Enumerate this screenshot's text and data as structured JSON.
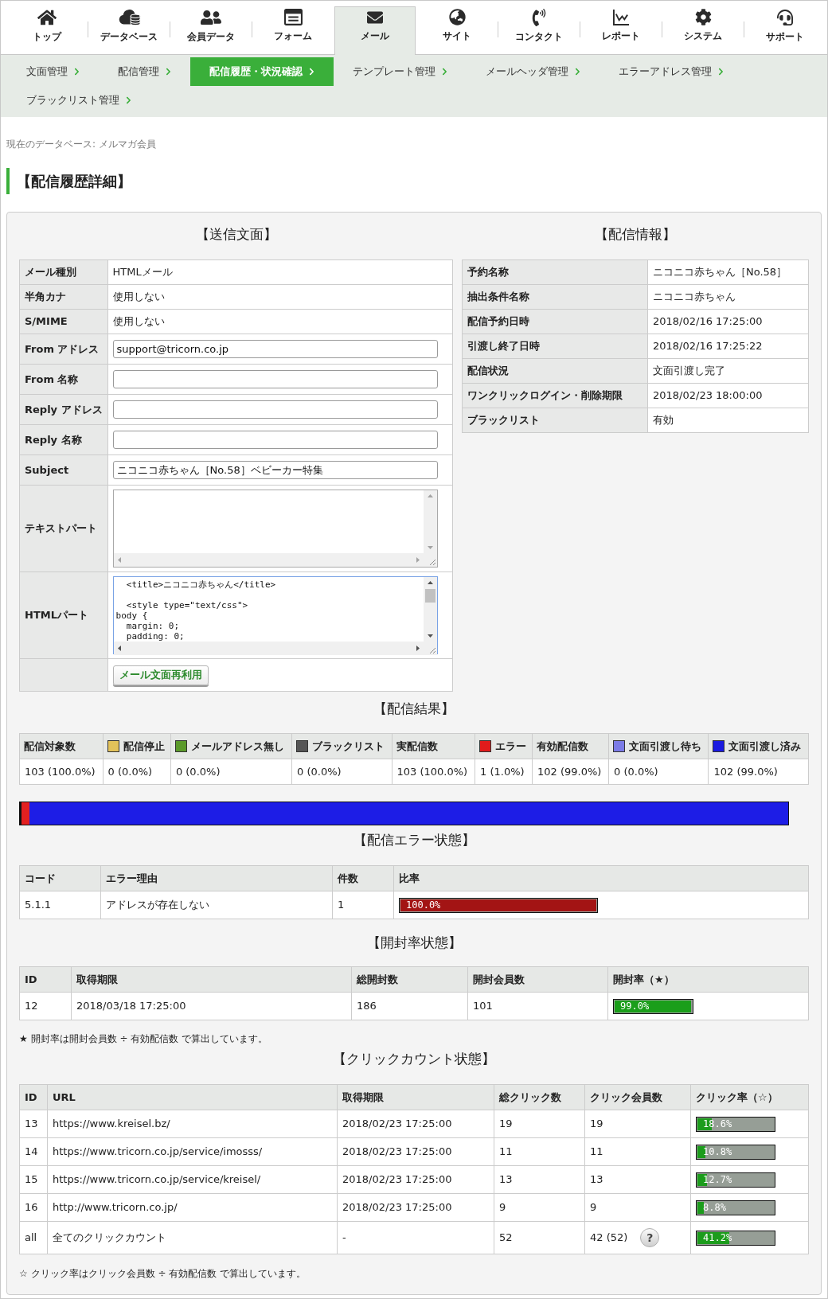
{
  "top_nav": {
    "items": [
      {
        "label": "トップ",
        "selected": false
      },
      {
        "label": "データベース",
        "selected": false
      },
      {
        "label": "会員データ",
        "selected": false
      },
      {
        "label": "フォーム",
        "selected": false
      },
      {
        "label": "メール",
        "selected": true
      },
      {
        "label": "サイト",
        "selected": false
      },
      {
        "label": "コンタクト",
        "selected": false
      },
      {
        "label": "レポート",
        "selected": false
      },
      {
        "label": "システム",
        "selected": false
      },
      {
        "label": "サポート",
        "selected": false
      }
    ]
  },
  "sub_nav": {
    "items": [
      {
        "label": "文面管理",
        "selected": false
      },
      {
        "label": "配信管理",
        "selected": false
      },
      {
        "label": "配信履歴・状況確認",
        "selected": true
      },
      {
        "label": "テンプレート管理",
        "selected": false
      },
      {
        "label": "メールヘッダ管理",
        "selected": false
      },
      {
        "label": "エラーアドレス管理",
        "selected": false
      },
      {
        "label": "ブラックリスト管理",
        "selected": false
      }
    ]
  },
  "current_database": "現在のデータベース: メルマガ会員",
  "page_title": "【配信履歴詳細】",
  "mail_content": {
    "title": "【送信文面】",
    "rows": [
      {
        "kind": "text",
        "label": "メール種別",
        "value": "HTMLメール"
      },
      {
        "kind": "text",
        "label": "半角カナ",
        "value": "使用しない"
      },
      {
        "kind": "text",
        "label": "S/MIME",
        "value": "使用しない"
      },
      {
        "kind": "input",
        "label": "From アドレス",
        "value": "support@tricorn.co.jp"
      },
      {
        "kind": "input",
        "label": "From 名称"
      },
      {
        "kind": "input",
        "label": "Reply アドレス"
      },
      {
        "kind": "input",
        "label": "Reply 名称"
      },
      {
        "kind": "input",
        "label": "Subject",
        "value": "ニコニコ赤ちゃん［No.58］ベビーカー特集"
      },
      {
        "kind": "textarea",
        "label": "テキストパート",
        "focused": false
      },
      {
        "kind": "textarea",
        "label": "HTMLパート",
        "focused": true,
        "value": "  <title>ニコニコ赤ちゃん</title>\n\n  <style type=\"text/css\">\nbody {\n  margin: 0;\n  padding: 0;"
      },
      {
        "kind": "button",
        "button": "メール文面再利用"
      }
    ]
  },
  "delivery_info": {
    "title": "【配信情報】",
    "rows": [
      {
        "label": "予約名称",
        "value": "ニコニコ赤ちゃん［No.58］"
      },
      {
        "label": "抽出条件名称",
        "value": "ニコニコ赤ちゃん"
      },
      {
        "label": "配信予約日時",
        "value": "2018/02/16 17:25:00"
      },
      {
        "label": "引渡し終了日時",
        "value": "2018/02/16 17:25:22"
      },
      {
        "label": "配信状況",
        "value": "文面引渡し完了"
      },
      {
        "label": "ワンクリックログイン・削除期限",
        "value": "2018/02/23 18:00:00"
      },
      {
        "label": "ブラックリスト",
        "value": "有効"
      }
    ]
  },
  "delivery_results": {
    "title": "【配信結果】",
    "columns": [
      {
        "label": "配信対象数"
      },
      {
        "label": "配信停止",
        "color": "#e3c25a"
      },
      {
        "label": "メールアドレス無し",
        "color": "#5b9a2a"
      },
      {
        "label": "ブラックリスト",
        "color": "#555555"
      },
      {
        "label": "実配信数"
      },
      {
        "label": "エラー",
        "color": "#e01b1b"
      },
      {
        "label": "有効配信数"
      },
      {
        "label": "文面引渡し待ち",
        "color": "#7b7be6"
      },
      {
        "label": "文面引渡し済み",
        "color": "#1a1ae0"
      }
    ],
    "values": [
      "103 (100.0%)",
      "0 (0.0%)",
      "0 (0.0%)",
      "0 (0.0%)",
      "103 (100.0%)",
      "1 (1.0%)",
      "102 (99.0%)",
      "0 (0.0%)",
      "102 (99.0%)"
    ],
    "bar": [
      {
        "color": "#e32020",
        "level": 0.01
      },
      {
        "color": "#1d1de6",
        "level": 0.99
      }
    ]
  },
  "error_status": {
    "title": "【配信エラー状態】",
    "columns": [
      "コード",
      "エラー理由",
      "件数",
      "比率"
    ],
    "rows": [
      {
        "code": "5.1.1",
        "reason": "アドレスが存在しない",
        "count": "1",
        "rate": "100.0%",
        "level": 1
      }
    ]
  },
  "open_status": {
    "title": "【開封率状態】",
    "columns": [
      "ID",
      "取得期限",
      "総開封数",
      "開封会員数",
      "開封率（★）"
    ],
    "rows": [
      {
        "id": "12",
        "deadline": "2018/03/18 17:25:00",
        "total_opens": "186",
        "members": "101",
        "rate": "99.0%",
        "level": 0.99
      }
    ],
    "note": "★ 開封率は開封会員数 ÷ 有効配信数 で算出しています。"
  },
  "click_status": {
    "title": "【クリックカウント状態】",
    "columns": [
      "ID",
      "URL",
      "取得期限",
      "総クリック数",
      "クリック会員数",
      "クリック率（☆）"
    ],
    "rows": [
      {
        "id": "13",
        "url": "https://www.kreisel.bz/",
        "deadline": "2018/02/23 17:25:00",
        "total_clicks": "19",
        "members": "19",
        "rate": "18.6%",
        "level": 0.186
      },
      {
        "id": "14",
        "url": "https://www.tricorn.co.jp/service/imosss/",
        "deadline": "2018/02/23 17:25:00",
        "total_clicks": "11",
        "members": "11",
        "rate": "10.8%",
        "level": 0.108
      },
      {
        "id": "15",
        "url": "https://www.tricorn.co.jp/service/kreisel/",
        "deadline": "2018/02/23 17:25:00",
        "total_clicks": "13",
        "members": "13",
        "rate": "12.7%",
        "level": 0.127
      },
      {
        "id": "16",
        "url": "http://www.tricorn.co.jp/",
        "deadline": "2018/02/23 17:25:00",
        "total_clicks": "9",
        "members": "9",
        "rate": "8.8%",
        "level": 0.088
      },
      {
        "id": "all",
        "url": "全てのクリックカウント",
        "deadline": "-",
        "total_clicks": "52",
        "members": "42 (52)",
        "help": "?",
        "rate": "41.2%",
        "level": 0.412
      }
    ],
    "note": "☆ クリック率はクリック会員数 ÷ 有効配信数 で算出しています。"
  }
}
